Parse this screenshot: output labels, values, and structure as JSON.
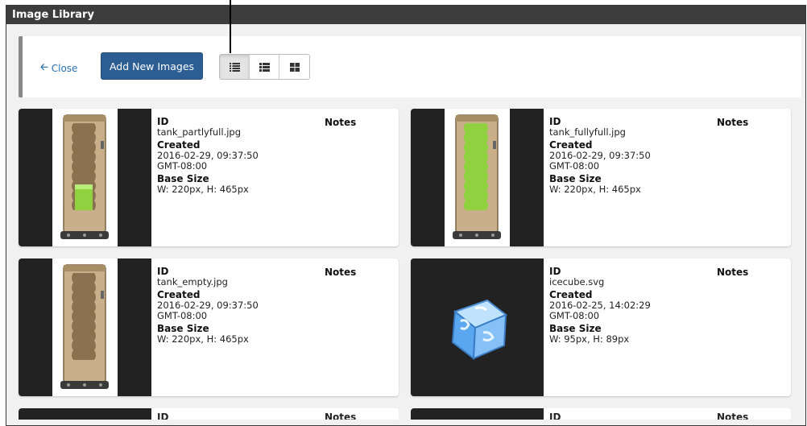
{
  "window": {
    "title": "Image Library"
  },
  "toolbar": {
    "close_label": "Close",
    "add_label": "Add New Images",
    "view_modes": [
      {
        "name": "list-view",
        "icon": "list-icon",
        "active": true
      },
      {
        "name": "detail-view",
        "icon": "detail-list-icon",
        "active": false
      },
      {
        "name": "grid-view",
        "icon": "grid-icon",
        "active": false
      }
    ]
  },
  "labels": {
    "id": "ID",
    "created": "Created",
    "base_size": "Base Size",
    "notes": "Notes"
  },
  "images": [
    {
      "id": "tank_partlyfull.jpg",
      "created": "2016-02-29, 09:37:50",
      "tz": "GMT-08:00",
      "size": "W: 220px, H: 465px",
      "thumb": "tank-partly-full",
      "fill": 0.35
    },
    {
      "id": "tank_fullyfull.jpg",
      "created": "2016-02-29, 09:37:50",
      "tz": "GMT-08:00",
      "size": "W: 220px, H: 465px",
      "thumb": "tank-fully-full",
      "fill": 1.0
    },
    {
      "id": "tank_empty.jpg",
      "created": "2016-02-29, 09:37:50",
      "tz": "GMT-08:00",
      "size": "W: 220px, H: 465px",
      "thumb": "tank-empty",
      "fill": 0
    },
    {
      "id": "icecube.svg",
      "created": "2016-02-25, 14:02:29",
      "tz": "GMT-08:00",
      "size": "W: 95px, H: 89px",
      "thumb": "ice-cube",
      "fill": 0
    }
  ],
  "colors": {
    "accent": "#2c5d93",
    "link": "#2a6fb0",
    "titlebar": "#3d3d3d",
    "tank_liquid": "#8fd13f"
  }
}
